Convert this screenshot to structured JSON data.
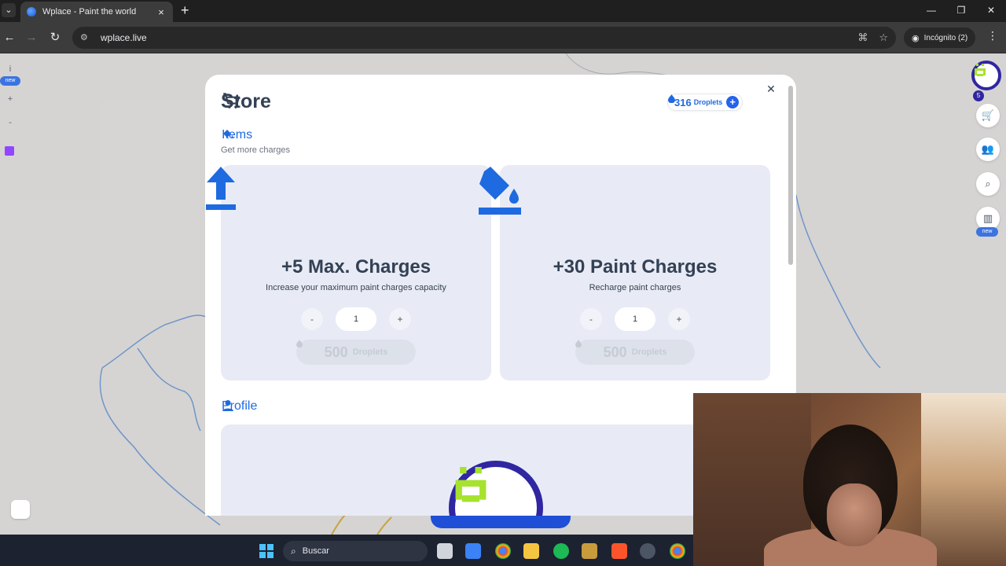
{
  "browser": {
    "tab_title": "Wplace - Paint the world",
    "url": "wplace.live",
    "profile_label": "Incógnito (2)"
  },
  "map": {
    "left_rail_new": "new",
    "right_rail_new": "new",
    "level": "5"
  },
  "store": {
    "title": "Store",
    "droplets_amount": "316",
    "droplets_unit": "Droplets",
    "items_section": {
      "title": "Items",
      "subtitle": "Get more charges"
    },
    "items": [
      {
        "title": "+5 Max. Charges",
        "description": "Increase your maximum paint charges capacity",
        "minus": "-",
        "quantity": "1",
        "plus": "+",
        "price": "500",
        "price_unit": "Droplets"
      },
      {
        "title": "+30 Paint Charges",
        "description": "Recharge paint charges",
        "minus": "-",
        "quantity": "1",
        "plus": "+",
        "price": "500",
        "price_unit": "Droplets"
      }
    ],
    "profile_section": {
      "title": "Profile"
    }
  },
  "taskbar": {
    "search_placeholder": "Buscar"
  },
  "colors": {
    "accent": "#1e6ae0",
    "card_bg": "#e8ebf5",
    "avatar_ring": "#3026a1",
    "avatar_face": "#a6e22e"
  },
  "icons": [
    "cart-icon",
    "paint-bucket-icon",
    "upload-arrow-icon",
    "person-icon",
    "droplet-icon",
    "plus-icon",
    "close-icon"
  ]
}
